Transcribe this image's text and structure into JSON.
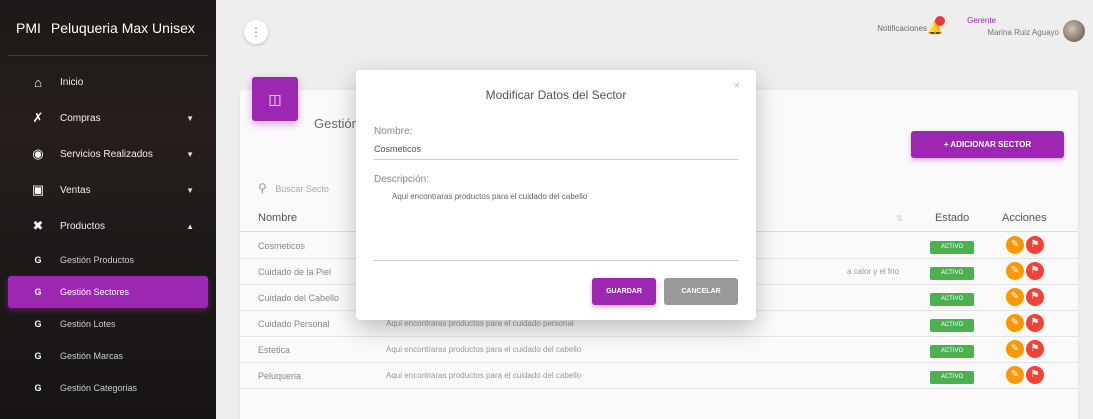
{
  "app": {
    "brand_mini": "PMI",
    "brand_name": "Peluqueria Max Unisex"
  },
  "sidebar": {
    "items": [
      {
        "label": "Inicio",
        "icon": "home-icon",
        "has_caret": false
      },
      {
        "label": "Compras",
        "icon": "shopping-off-icon",
        "has_caret": true
      },
      {
        "label": "Servicios Realizados",
        "icon": "service-icon",
        "has_caret": true
      },
      {
        "label": "Ventas",
        "icon": "cart-icon",
        "has_caret": true
      },
      {
        "label": "Productos",
        "icon": "product-icon",
        "has_caret": true,
        "expanded": true
      }
    ],
    "subitems": [
      {
        "prefix": "G",
        "label": "Gestión Productos",
        "active": false
      },
      {
        "prefix": "G",
        "label": "Gestión Sectores",
        "active": true
      },
      {
        "prefix": "G",
        "label": "Gestión Lotes",
        "active": false
      },
      {
        "prefix": "G",
        "label": "Gestión Marcas",
        "active": false
      },
      {
        "prefix": "G",
        "label": "Gestión Categorias",
        "active": false
      }
    ]
  },
  "topbar": {
    "notifications_label": "Notificaciones",
    "notifications_count": "",
    "user_role": "Gerente",
    "user_name": "Marina Ruiz Aguayo"
  },
  "card": {
    "title": "Gestión",
    "add_button": "+ ADICIONAR SECTOR",
    "search_placeholder": "Buscar Secto",
    "columns": {
      "name": "Nombre",
      "status": "Estado",
      "actions": "Acciones"
    },
    "rows": [
      {
        "name": "Cosmeticos",
        "desc": "",
        "status": "ACTIVO"
      },
      {
        "name": "Cuidado de la Piel",
        "desc": "a calor y el frio",
        "status": "ACTIVO"
      },
      {
        "name": "Cuidado del Cabello",
        "desc": "",
        "status": "ACTIVO"
      },
      {
        "name": "Cuidado Personal",
        "desc": "Aqui encontraras productos para el cuidado personal",
        "status": "ACTIVO"
      },
      {
        "name": "Estetica",
        "desc": "Aqui encontraras productos para el cuidado del cabello",
        "status": "ACTIVO"
      },
      {
        "name": "Peluqueria",
        "desc": "Aqui encontraras productos para el cuidado del cabello",
        "status": "ACTIVO"
      }
    ]
  },
  "modal": {
    "title": "Modificar Datos del Sector",
    "close": "×",
    "name_label": "Nombre:",
    "name_value": "Cosmeticos",
    "desc_label": "Descripción:",
    "desc_value": "Aqui encontraras productos para el cuidado del cabello",
    "save": "GUARDAR",
    "cancel": "CANCELAR"
  },
  "colors": {
    "accent": "#9c27b0",
    "status": "#4caf50",
    "edit": "#ff9800",
    "delete": "#f44336"
  }
}
